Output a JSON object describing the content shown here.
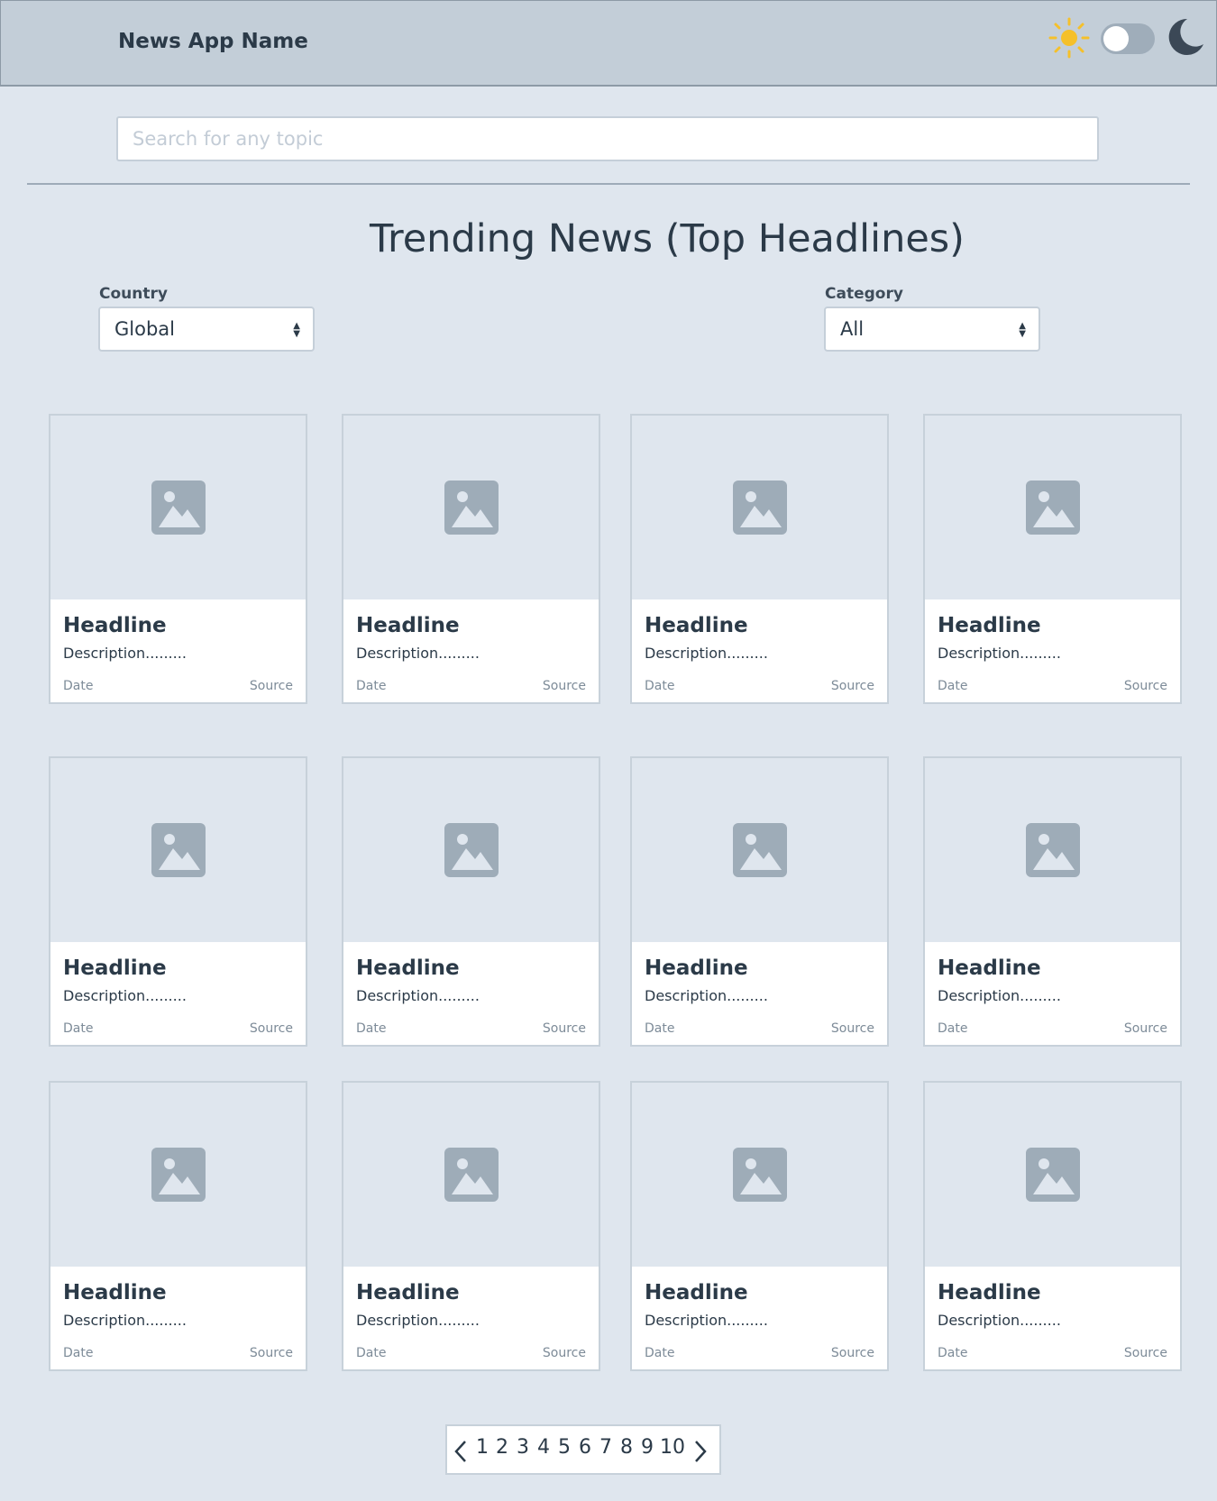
{
  "header": {
    "app_name": "News App Name",
    "light_icon": "sun-icon",
    "dark_icon": "moon-icon",
    "theme_toggle": "off",
    "sun_color": "#f5c02a"
  },
  "search": {
    "placeholder": "Search for any topic",
    "value": ""
  },
  "main": {
    "title": "Trending News (Top Headlines)"
  },
  "filters": {
    "country": {
      "label": "Country",
      "value": "Global"
    },
    "category": {
      "label": "Category",
      "value": "All"
    }
  },
  "cards": [
    {
      "headline": "Headline",
      "description": "Description.........",
      "date": "Date",
      "source": "Source",
      "image": "image-placeholder-icon"
    },
    {
      "headline": "Headline",
      "description": "Description.........",
      "date": "Date",
      "source": "Source",
      "image": "image-placeholder-icon"
    },
    {
      "headline": "Headline",
      "description": "Description.........",
      "date": "Date",
      "source": "Source",
      "image": "image-placeholder-icon"
    },
    {
      "headline": "Headline",
      "description": "Description.........",
      "date": "Date",
      "source": "Source",
      "image": "image-placeholder-icon"
    },
    {
      "headline": "Headline",
      "description": "Description.........",
      "date": "Date",
      "source": "Source",
      "image": "image-placeholder-icon"
    },
    {
      "headline": "Headline",
      "description": "Description.........",
      "date": "Date",
      "source": "Source",
      "image": "image-placeholder-icon"
    },
    {
      "headline": "Headline",
      "description": "Description.........",
      "date": "Date",
      "source": "Source",
      "image": "image-placeholder-icon"
    },
    {
      "headline": "Headline",
      "description": "Description.........",
      "date": "Date",
      "source": "Source",
      "image": "image-placeholder-icon"
    },
    {
      "headline": "Headline",
      "description": "Description.........",
      "date": "Date",
      "source": "Source",
      "image": "image-placeholder-icon"
    },
    {
      "headline": "Headline",
      "description": "Description.........",
      "date": "Date",
      "source": "Source",
      "image": "image-placeholder-icon"
    },
    {
      "headline": "Headline",
      "description": "Description.........",
      "date": "Date",
      "source": "Source",
      "image": "image-placeholder-icon"
    },
    {
      "headline": "Headline",
      "description": "Description.........",
      "date": "Date",
      "source": "Source",
      "image": "image-placeholder-icon"
    }
  ],
  "pagination": {
    "pages": [
      "1",
      "2",
      "3",
      "4",
      "5",
      "6",
      "7",
      "8",
      "9",
      "10"
    ],
    "prev_icon": "chevron-left-icon",
    "next_icon": "chevron-right-icon"
  },
  "colors": {
    "background": "#dfe6ee",
    "header_background": "#c3ced8",
    "text": "#2b3a48",
    "placeholder_icon": "#9eacb8"
  }
}
